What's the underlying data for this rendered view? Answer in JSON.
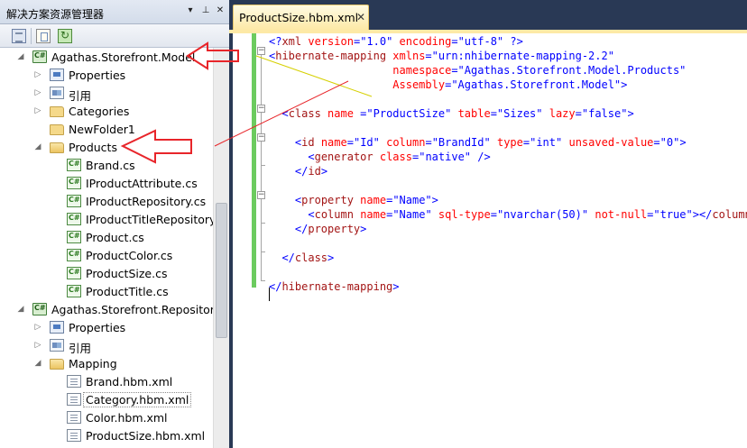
{
  "solution_explorer": {
    "title": "解决方案资源管理器",
    "title_buttons": [
      "▾",
      "⊥",
      "✕"
    ],
    "tree": [
      {
        "label": "Agathas.Storefront.Model",
        "icon": "csharp-project-icon",
        "expander": "◢",
        "level": 0,
        "bold": false
      },
      {
        "label": "Properties",
        "icon": "properties-icon",
        "expander": "▷",
        "level": 1
      },
      {
        "label": "引用",
        "icon": "references-icon",
        "expander": "▷",
        "level": 1
      },
      {
        "label": "Categories",
        "icon": "folder-icon",
        "expander": "▷",
        "level": 1
      },
      {
        "label": "NewFolder1",
        "icon": "folder-icon",
        "expander": "",
        "level": 1
      },
      {
        "label": "Products",
        "icon": "folder-open-icon",
        "expander": "◢",
        "level": 1
      },
      {
        "label": "Brand.cs",
        "icon": "csharp-file-icon",
        "expander": "",
        "level": 2
      },
      {
        "label": "IProductAttribute.cs",
        "icon": "csharp-file-icon",
        "expander": "",
        "level": 2
      },
      {
        "label": "IProductRepository.cs",
        "icon": "csharp-file-icon",
        "expander": "",
        "level": 2
      },
      {
        "label": "IProductTitleRepository.cs",
        "icon": "csharp-file-icon",
        "expander": "",
        "level": 2
      },
      {
        "label": "Product.cs",
        "icon": "csharp-file-icon",
        "expander": "",
        "level": 2
      },
      {
        "label": "ProductColor.cs",
        "icon": "csharp-file-icon",
        "expander": "",
        "level": 2
      },
      {
        "label": "ProductSize.cs",
        "icon": "csharp-file-icon",
        "expander": "",
        "level": 2
      },
      {
        "label": "ProductTitle.cs",
        "icon": "csharp-file-icon",
        "expander": "",
        "level": 2
      },
      {
        "label": "Agathas.Storefront.Repository.NHibernate",
        "icon": "csharp-project-icon",
        "expander": "◢",
        "level": 0
      },
      {
        "label": "Properties",
        "icon": "properties-icon",
        "expander": "▷",
        "level": 1
      },
      {
        "label": "引用",
        "icon": "references-icon",
        "expander": "▷",
        "level": 1
      },
      {
        "label": "Mapping",
        "icon": "folder-open-icon",
        "expander": "◢",
        "level": 1
      },
      {
        "label": "Brand.hbm.xml",
        "icon": "xml-file-icon",
        "expander": "",
        "level": 2
      },
      {
        "label": "Category.hbm.xml",
        "icon": "xml-file-icon",
        "expander": "",
        "level": 2,
        "selected": true
      },
      {
        "label": "Color.hbm.xml",
        "icon": "xml-file-icon",
        "expander": "",
        "level": 2
      },
      {
        "label": "ProductSize.hbm.xml",
        "icon": "xml-file-icon",
        "expander": "",
        "level": 2
      }
    ]
  },
  "editor": {
    "tab_label": "ProductSize.hbm.xml",
    "tab_close": "✕",
    "lines": [
      [
        {
          "t": "<?",
          "c": "blue"
        },
        {
          "t": "xml",
          "c": "mar"
        },
        {
          "t": " ",
          "c": ""
        },
        {
          "t": "version",
          "c": "red"
        },
        {
          "t": "=",
          "c": "blue"
        },
        {
          "t": "\"1.0\"",
          "c": "q"
        },
        {
          "t": " ",
          "c": ""
        },
        {
          "t": "encoding",
          "c": "red"
        },
        {
          "t": "=",
          "c": "blue"
        },
        {
          "t": "\"utf-8\"",
          "c": "q"
        },
        {
          "t": " ?>",
          "c": "blue"
        }
      ],
      [
        {
          "t": "<",
          "c": "blue"
        },
        {
          "t": "hibernate-mapping",
          "c": "mar"
        },
        {
          "t": " ",
          "c": ""
        },
        {
          "t": "xmlns",
          "c": "red"
        },
        {
          "t": "=",
          "c": "blue"
        },
        {
          "t": "\"urn:nhibernate-mapping-2.2\"",
          "c": "q"
        }
      ],
      [
        {
          "t": "                   ",
          "c": ""
        },
        {
          "t": "namespace",
          "c": "red"
        },
        {
          "t": "=",
          "c": "blue"
        },
        {
          "t": "\"Agathas.Storefront.Model.Products\"",
          "c": "q"
        }
      ],
      [
        {
          "t": "                   ",
          "c": ""
        },
        {
          "t": "Assembly",
          "c": "red"
        },
        {
          "t": "=",
          "c": "blue"
        },
        {
          "t": "\"Agathas.Storefront.Model\"",
          "c": "q"
        },
        {
          "t": ">",
          "c": "blue"
        }
      ],
      [],
      [
        {
          "t": "  ",
          "c": ""
        },
        {
          "t": "<",
          "c": "blue"
        },
        {
          "t": "class",
          "c": "mar"
        },
        {
          "t": " ",
          "c": ""
        },
        {
          "t": "name",
          "c": "red"
        },
        {
          "t": " =",
          "c": "blue"
        },
        {
          "t": "\"ProductSize\"",
          "c": "q"
        },
        {
          "t": " ",
          "c": ""
        },
        {
          "t": "table",
          "c": "red"
        },
        {
          "t": "=",
          "c": "blue"
        },
        {
          "t": "\"Sizes\"",
          "c": "q"
        },
        {
          "t": " ",
          "c": ""
        },
        {
          "t": "lazy",
          "c": "red"
        },
        {
          "t": "=",
          "c": "blue"
        },
        {
          "t": "\"false\"",
          "c": "q"
        },
        {
          "t": ">",
          "c": "blue"
        }
      ],
      [],
      [
        {
          "t": "    ",
          "c": ""
        },
        {
          "t": "<",
          "c": "blue"
        },
        {
          "t": "id",
          "c": "mar"
        },
        {
          "t": " ",
          "c": ""
        },
        {
          "t": "name",
          "c": "red"
        },
        {
          "t": "=",
          "c": "blue"
        },
        {
          "t": "\"Id\"",
          "c": "q"
        },
        {
          "t": " ",
          "c": ""
        },
        {
          "t": "column",
          "c": "red"
        },
        {
          "t": "=",
          "c": "blue"
        },
        {
          "t": "\"BrandId\"",
          "c": "q"
        },
        {
          "t": " ",
          "c": ""
        },
        {
          "t": "type",
          "c": "red"
        },
        {
          "t": "=",
          "c": "blue"
        },
        {
          "t": "\"int\"",
          "c": "q"
        },
        {
          "t": " ",
          "c": ""
        },
        {
          "t": "unsaved-value",
          "c": "red"
        },
        {
          "t": "=",
          "c": "blue"
        },
        {
          "t": "\"0\"",
          "c": "q"
        },
        {
          "t": ">",
          "c": "blue"
        }
      ],
      [
        {
          "t": "      ",
          "c": ""
        },
        {
          "t": "<",
          "c": "blue"
        },
        {
          "t": "generator",
          "c": "mar"
        },
        {
          "t": " ",
          "c": ""
        },
        {
          "t": "class",
          "c": "red"
        },
        {
          "t": "=",
          "c": "blue"
        },
        {
          "t": "\"native\"",
          "c": "q"
        },
        {
          "t": " />",
          "c": "blue"
        }
      ],
      [
        {
          "t": "    ",
          "c": ""
        },
        {
          "t": "</",
          "c": "blue"
        },
        {
          "t": "id",
          "c": "mar"
        },
        {
          "t": ">",
          "c": "blue"
        }
      ],
      [],
      [
        {
          "t": "    ",
          "c": ""
        },
        {
          "t": "<",
          "c": "blue"
        },
        {
          "t": "property",
          "c": "mar"
        },
        {
          "t": " ",
          "c": ""
        },
        {
          "t": "name",
          "c": "red"
        },
        {
          "t": "=",
          "c": "blue"
        },
        {
          "t": "\"Name\"",
          "c": "q"
        },
        {
          "t": ">",
          "c": "blue"
        }
      ],
      [
        {
          "t": "      ",
          "c": ""
        },
        {
          "t": "<",
          "c": "blue"
        },
        {
          "t": "column",
          "c": "mar"
        },
        {
          "t": " ",
          "c": ""
        },
        {
          "t": "name",
          "c": "red"
        },
        {
          "t": "=",
          "c": "blue"
        },
        {
          "t": "\"Name\"",
          "c": "q"
        },
        {
          "t": " ",
          "c": ""
        },
        {
          "t": "sql-type",
          "c": "red"
        },
        {
          "t": "=",
          "c": "blue"
        },
        {
          "t": "\"nvarchar(50)\"",
          "c": "q"
        },
        {
          "t": " ",
          "c": ""
        },
        {
          "t": "not-null",
          "c": "red"
        },
        {
          "t": "=",
          "c": "blue"
        },
        {
          "t": "\"true\"",
          "c": "q"
        },
        {
          "t": "></",
          "c": "blue"
        },
        {
          "t": "column",
          "c": "mar"
        },
        {
          "t": ">",
          "c": "blue"
        }
      ],
      [
        {
          "t": "    ",
          "c": ""
        },
        {
          "t": "</",
          "c": "blue"
        },
        {
          "t": "property",
          "c": "mar"
        },
        {
          "t": ">",
          "c": "blue"
        }
      ],
      [],
      [
        {
          "t": "  ",
          "c": ""
        },
        {
          "t": "</",
          "c": "blue"
        },
        {
          "t": "class",
          "c": "mar"
        },
        {
          "t": ">",
          "c": "blue"
        }
      ],
      [],
      [
        {
          "t": "</",
          "c": "blue"
        },
        {
          "t": "hibernate-mapping",
          "c": "mar"
        },
        {
          "t": ">",
          "c": "blue"
        }
      ]
    ]
  },
  "colors": {
    "chrome": "#293955",
    "tab_active": "#fde9a6",
    "change_bar": "#6ccb5f",
    "annotation_arrow": "#e8252a"
  }
}
